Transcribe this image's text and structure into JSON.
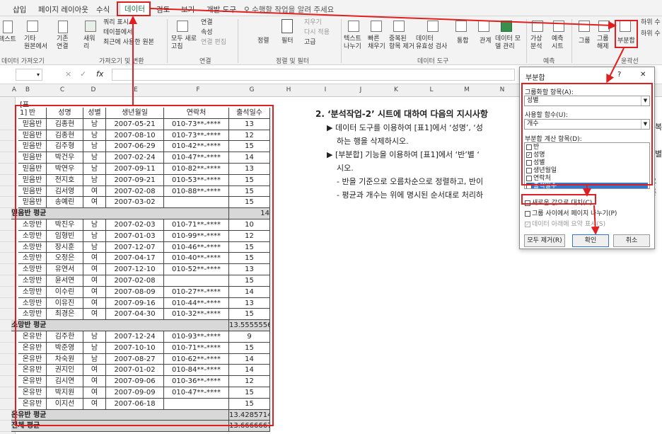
{
  "tabs": [
    "삽입",
    "페이지 레이아웃",
    "수식",
    "데이터",
    "검토",
    "보기",
    "개발 도구",
    "♀ 수행할 작업을 알려 주세요"
  ],
  "ribbon": {
    "items": [
      "텍스트",
      "기타\n원본에서",
      "기존\n연결",
      "새워\n리",
      "쿼리 표시",
      "테이블에서",
      "최근에 사용한 원본",
      "모두 새로\n고침",
      "연결",
      "속성",
      "연결 편집",
      "정렬",
      "필터",
      "지우기",
      "다시 적용",
      "고급",
      "텍스트\n나누기",
      "빠른\n채우기",
      "중복된\n항목 제거",
      "데이터\n유효성 검사",
      "통합",
      "관계",
      "데이터 모\n델 관리",
      "가상\n분석",
      "예측\n시트",
      "그룹",
      "그룹\n해제",
      "부분합",
      "하위 수",
      "하위 수"
    ],
    "groups": [
      "데이터 가져오기",
      "가져오기 및 변환",
      "연결",
      "정렬 및 필터",
      "데이터 도구",
      "예측",
      "윤곽선"
    ]
  },
  "formula_bar": {
    "fx": "fx",
    "cancel": "×",
    "enter": "✓"
  },
  "columns": [
    "A",
    "B",
    "C",
    "D",
    "E",
    "F",
    "G",
    "H",
    "I",
    "J",
    "K",
    "L",
    "M",
    "N"
  ],
  "table_label": "[표1]",
  "table_headers": [
    "반",
    "성명",
    "성별",
    "생년월일",
    "연락처",
    "출석일수"
  ],
  "rows": [
    [
      "믿음반",
      "김종현",
      "남",
      "2007-05-21",
      "010-73**-****",
      "13"
    ],
    [
      "믿음반",
      "김종현",
      "남",
      "2007-08-10",
      "010-73**-****",
      "12"
    ],
    [
      "믿음반",
      "김주형",
      "남",
      "2007-06-29",
      "010-42**-****",
      "15"
    ],
    [
      "믿음반",
      "박건우",
      "남",
      "2007-02-24",
      "010-47**-****",
      "14"
    ],
    [
      "믿음반",
      "박연우",
      "남",
      "2007-09-11",
      "010-82**-****",
      "13"
    ],
    [
      "믿음반",
      "전지호",
      "남",
      "2007-09-21",
      "010-53**-****",
      "15"
    ],
    [
      "믿음반",
      "김서영",
      "여",
      "2007-02-08",
      "010-88**-****",
      "15"
    ],
    [
      "믿음반",
      "송예린",
      "여",
      "2007-03-02",
      "",
      "15"
    ],
    [
      "믿음반 평균",
      "",
      "",
      "",
      "",
      "14"
    ],
    [
      "소망반",
      "박진우",
      "남",
      "2007-02-03",
      "010-71**-****",
      "10"
    ],
    [
      "소망반",
      "임형빈",
      "남",
      "2007-01-03",
      "010-99**-****",
      "12"
    ],
    [
      "소망반",
      "장시훈",
      "남",
      "2007-12-07",
      "010-46**-****",
      "15"
    ],
    [
      "소망반",
      "오정은",
      "여",
      "2007-04-17",
      "010-40**-****",
      "15"
    ],
    [
      "소망반",
      "유연서",
      "여",
      "2007-12-10",
      "010-52**-****",
      "13"
    ],
    [
      "소망반",
      "윤서연",
      "여",
      "2007-02-08",
      "",
      "15"
    ],
    [
      "소망반",
      "이수린",
      "여",
      "2007-08-09",
      "010-27**-****",
      "14"
    ],
    [
      "소망반",
      "이유진",
      "여",
      "2007-09-16",
      "010-44**-****",
      "13"
    ],
    [
      "소망반",
      "최경은",
      "여",
      "2007-04-30",
      "010-32**-****",
      "15"
    ],
    [
      "소망반 평균",
      "",
      "",
      "",
      "",
      "13.5555556"
    ],
    [
      "온유반",
      "김주한",
      "남",
      "2007-12-24",
      "010-93**-****",
      "9"
    ],
    [
      "온유반",
      "박준영",
      "남",
      "2007-10-10",
      "010-71**-****",
      "15"
    ],
    [
      "온유반",
      "차숙원",
      "남",
      "2007-08-27",
      "010-62**-****",
      "14"
    ],
    [
      "온유반",
      "권지인",
      "여",
      "2007-01-02",
      "010-84**-****",
      "14"
    ],
    [
      "온유반",
      "김시연",
      "여",
      "2007-09-06",
      "010-36**-****",
      "12"
    ],
    [
      "온유반",
      "박지원",
      "여",
      "2007-09-09",
      "010-47**-****",
      "15"
    ],
    [
      "온유반",
      "이지선",
      "여",
      "2007-06-18",
      "",
      "15"
    ],
    [
      "온유반 평균",
      "",
      "",
      "",
      "",
      "13.4285714"
    ],
    [
      "전체 평균",
      "",
      "",
      "",
      "",
      "13.6666667"
    ]
  ],
  "instructions": {
    "heading": "2. ‘분석작업-2’ 시트에 대하여 다음의 지시사항",
    "b1": "▶ 데이터 도구를 이용하여 [표1]에서 ‘성명’, ‘성",
    "b1b": "복",
    "b1c": "하는 행을 삭제하시오.",
    "b2": "▶ [부분합] 기능을 이용하여 [표1]에서 ‘반’별 ‘",
    "b2b": "별",
    "b2c": "시오.",
    "b3": "- 반을 기준으로 오름차순으로 정렬하고, 반이",
    "b3b": "오른",
    "b4": "- 평균과 개수는 위에 명시된 순서대로 처리하"
  },
  "dialog": {
    "title": "부분합",
    "help": "?",
    "close": "✕",
    "group_label": "그룹화할 항목(A):",
    "group_value": "성별",
    "func_label": "사용할 함수(U):",
    "func_value": "개수",
    "items_label": "부분합 계산 항목(D):",
    "items": [
      {
        "label": "반",
        "checked": false
      },
      {
        "label": "성명",
        "checked": true
      },
      {
        "label": "성별",
        "checked": false
      },
      {
        "label": "생년월일",
        "checked": false
      },
      {
        "label": "연락처",
        "checked": false
      },
      {
        "label": "출석일수",
        "checked": false
      }
    ],
    "opt1": "새로운 값으로 대치(C)",
    "opt2": "그룹 사이에서 페이지 나누기(P)",
    "opt3": "데이터 아래에 요약 표시(S)",
    "remove_all": "모두 제거(R)",
    "ok": "확인",
    "cancel": "취소"
  },
  "colors": {
    "accent": "#217346",
    "red": "#e02020",
    "subtotal": "#d8d8d8"
  }
}
